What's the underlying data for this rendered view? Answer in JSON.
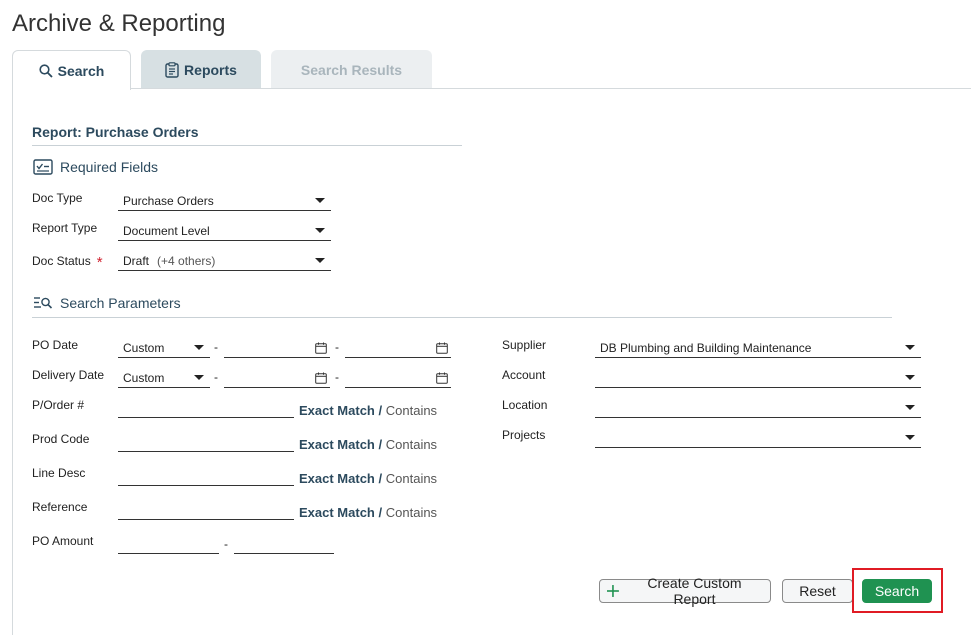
{
  "page_title": "Archive & Reporting",
  "tabs": [
    {
      "label": "Search",
      "icon": "search-icon",
      "state": "active"
    },
    {
      "label": "Reports",
      "icon": "clipboard-icon",
      "state": "inactive"
    },
    {
      "label": "Search Results",
      "state": "disabled"
    }
  ],
  "report": {
    "title": "Report: Purchase Orders"
  },
  "required": {
    "heading": "Required Fields",
    "doc_type": {
      "label": "Doc Type",
      "value": "Purchase Orders"
    },
    "report_type": {
      "label": "Report Type",
      "value": "Document Level"
    },
    "doc_status": {
      "label": "Doc Status",
      "required_mark": "*",
      "value": "Draft",
      "extra": "(+4 others)"
    }
  },
  "params": {
    "heading": "Search Parameters",
    "po_date": {
      "label": "PO Date",
      "mode": "Custom",
      "dash": "-"
    },
    "delivery_date": {
      "label": "Delivery Date",
      "mode": "Custom",
      "dash": "-"
    },
    "match_exact": "Exact Match",
    "match_sep": "/",
    "match_contains": "Contains",
    "porder": {
      "label": "P/Order #"
    },
    "prod_code": {
      "label": "Prod Code"
    },
    "line_desc": {
      "label": "Line Desc"
    },
    "reference": {
      "label": "Reference"
    },
    "po_amount": {
      "label": "PO Amount",
      "dash": "-"
    },
    "supplier": {
      "label": "Supplier",
      "value": "DB Plumbing and Building Maintenance"
    },
    "account": {
      "label": "Account",
      "value": ""
    },
    "location": {
      "label": "Location",
      "value": ""
    },
    "projects": {
      "label": "Projects",
      "value": ""
    }
  },
  "actions": {
    "create_custom": "Create Custom Report",
    "reset": "Reset",
    "search": "Search"
  },
  "colors": {
    "accent": "#2c4a5e",
    "primary": "#1f9251",
    "highlight": "#e01b24",
    "required": "#d0202e"
  }
}
